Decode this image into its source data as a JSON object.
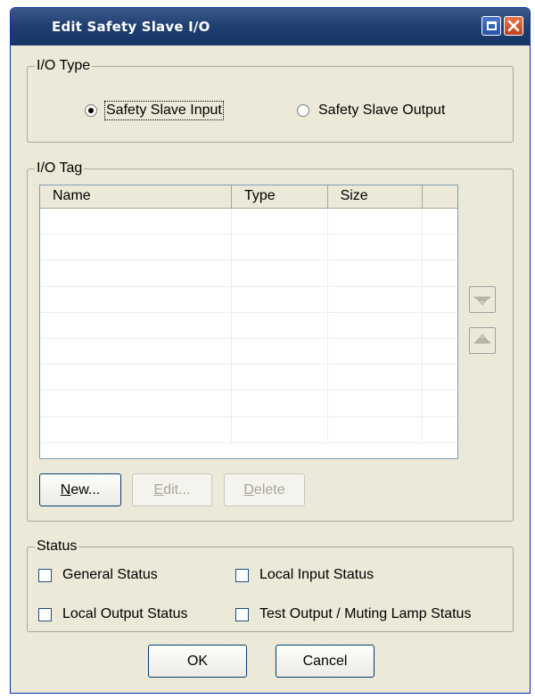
{
  "window": {
    "title": "Edit Safety Slave I/O"
  },
  "io_type": {
    "legend": "I/O Type",
    "options": [
      {
        "label": "Safety Slave Input",
        "selected": true
      },
      {
        "label": "Safety Slave Output",
        "selected": false
      }
    ]
  },
  "io_tag": {
    "legend": "I/O Tag",
    "columns": [
      "Name",
      "Type",
      "Size"
    ],
    "rows": [],
    "side_buttons": [
      "move-down-icon",
      "move-up-icon"
    ],
    "buttons": {
      "new_prefix": "N",
      "new_rest": "ew...",
      "edit_prefix": "E",
      "edit_rest": "dit...",
      "delete_prefix": "D",
      "delete_rest": "elete"
    }
  },
  "status": {
    "legend": "Status",
    "items": [
      {
        "label": "General Status",
        "checked": false
      },
      {
        "label": "Local Input Status",
        "checked": false
      },
      {
        "label": "Local Output Status",
        "checked": false
      },
      {
        "label": "Test Output / Muting Lamp Status",
        "checked": false
      }
    ]
  },
  "footer": {
    "ok": "OK",
    "cancel": "Cancel"
  },
  "colors": {
    "title_bar": "#1f3e70",
    "dialog_bg": "#ece9d8",
    "close_button": "#c2401c"
  }
}
